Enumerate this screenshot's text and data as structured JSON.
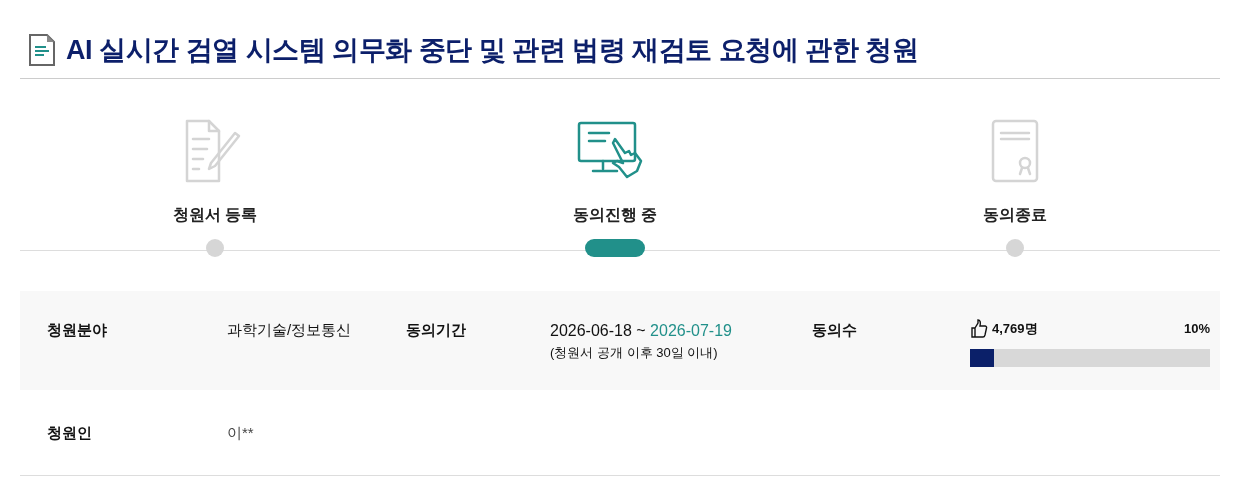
{
  "title": "AI 실시간 검열 시스템 의무화 중단 및 관련 법령 재검토 요청에 관한 청원",
  "steps": [
    {
      "kind": "register",
      "label": "청원서 등록",
      "selected": false
    },
    {
      "kind": "agree",
      "label": "동의진행 중",
      "selected": true
    },
    {
      "kind": "end",
      "label": "동의종료",
      "selected": false
    }
  ],
  "info": {
    "field_label": "청원분야",
    "field_value": "과학기술/정보통신",
    "period_label": "동의기간",
    "period_start": "2026-06-18",
    "period_sep": "~",
    "period_end": "2026-07-19",
    "period_note": "(청원서 공개 이후 30일 이내)",
    "count_label": "동의수",
    "count_value": "4,769명",
    "percent": "10%",
    "level": 0.1,
    "petitioner_label": "청원인",
    "petitioner_value": "이**"
  }
}
